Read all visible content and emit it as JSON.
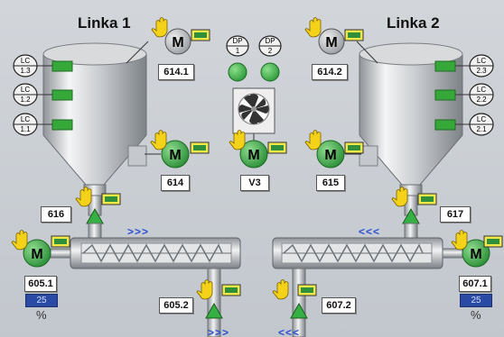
{
  "lines": [
    {
      "title": "Linka 1"
    },
    {
      "title": "Linka 2"
    }
  ],
  "level_controls": {
    "left": [
      "LC 1.3",
      "LC 1.2",
      "LC 1.1"
    ],
    "right": [
      "LC 2.3",
      "LC 2.2",
      "LC 2.1"
    ]
  },
  "level_controls_parts": {
    "left": [
      [
        "LC",
        "1.3"
      ],
      [
        "LC",
        "1.2"
      ],
      [
        "LC",
        "1.1"
      ]
    ],
    "right": [
      [
        "LC",
        "2.3"
      ],
      [
        "LC",
        "2.2"
      ],
      [
        "LC",
        "2.1"
      ]
    ]
  },
  "pressure": [
    {
      "top": "DP",
      "bottom": "1"
    },
    {
      "top": "DP",
      "bottom": "2"
    }
  ],
  "motor_letter": "M",
  "tags": {
    "m614_1": "614.1",
    "m614_2": "614.2",
    "m614": "614",
    "v3": "V3",
    "m615": "615",
    "valve616": "616",
    "valve617": "617",
    "m605_1": "605.1",
    "m607_1": "607.1",
    "m605_2": "605.2",
    "m607_2": "607.2"
  },
  "speeds": {
    "left": "25",
    "right": "25"
  },
  "unit": "%",
  "flow_arrows": {
    "conv_left": ">>>",
    "conv_right": "<<<",
    "bottom_left": ">>>",
    "bottom_right": "<<<"
  },
  "colors": {
    "running": "#3aa64a",
    "stopped": "#b8bcc2",
    "level_on": "#36a83a",
    "speed_box": "#2b4aa3"
  }
}
